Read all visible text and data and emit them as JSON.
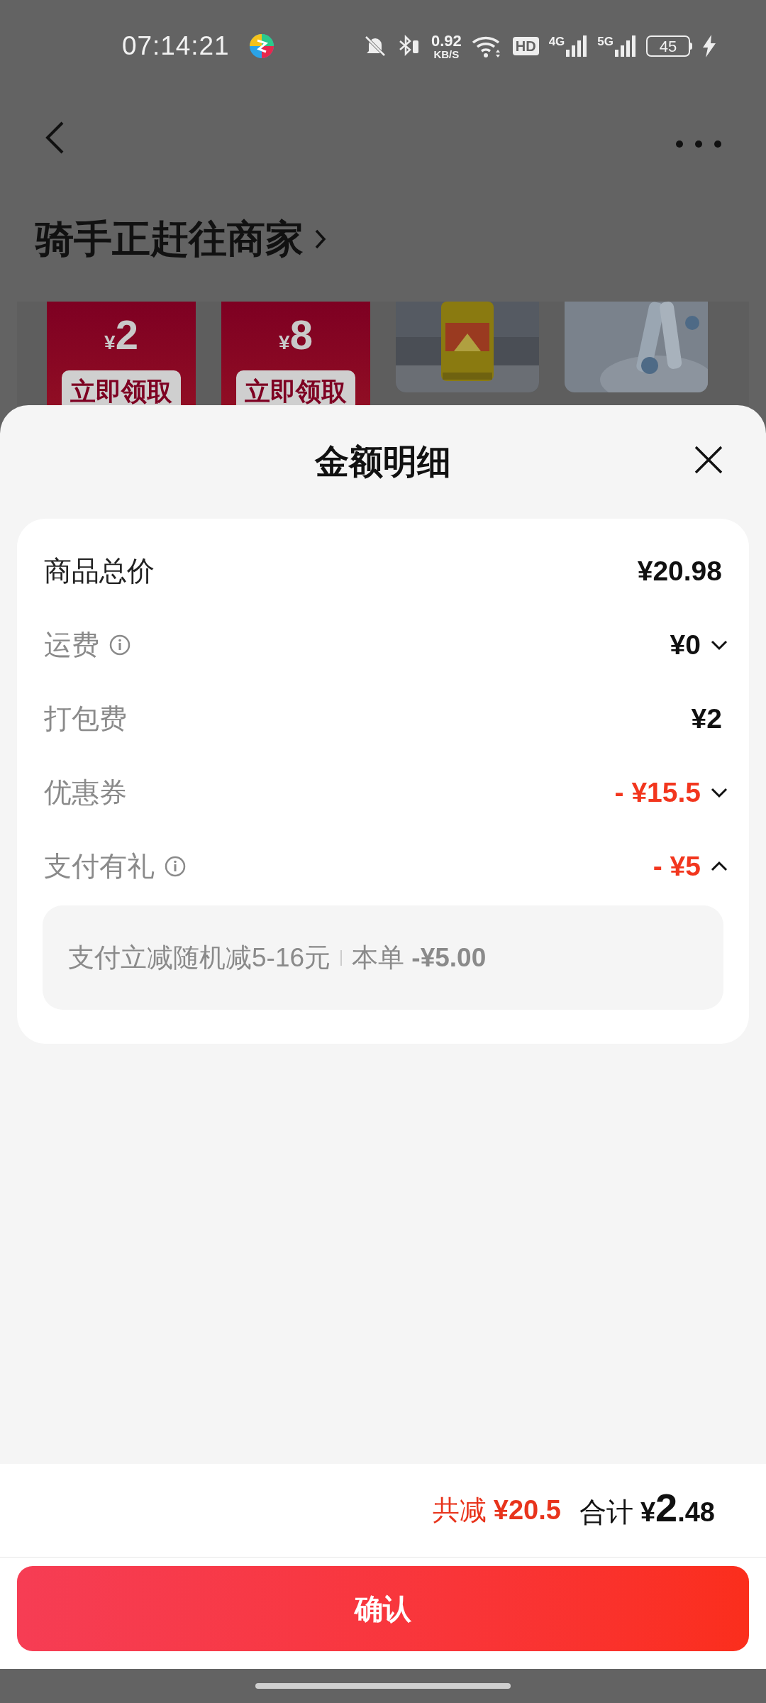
{
  "status_bar": {
    "time": "07:14:21",
    "net_speed": {
      "value": "0.92",
      "unit": "KB/S"
    },
    "hd_label": "HD",
    "signals": [
      {
        "label": "4G"
      },
      {
        "label": "5G"
      }
    ],
    "battery": "45",
    "charging": true
  },
  "top_bar": {
    "title": "骑手正赶往商家"
  },
  "promo_cards": [
    {
      "kind": "coupon",
      "currency": "¥",
      "amount": "2",
      "action": "立即领取"
    },
    {
      "kind": "coupon",
      "currency": "¥",
      "amount": "8",
      "action": "立即领取"
    },
    {
      "kind": "picture"
    },
    {
      "kind": "picture"
    }
  ],
  "sheet": {
    "title": "金额明细",
    "rows": [
      {
        "kind": "total",
        "label": "商品总价",
        "info": false,
        "value": "¥20.98"
      },
      {
        "kind": "fee",
        "label": "运费",
        "info": true,
        "value": "¥0",
        "expanded": false
      },
      {
        "kind": "fee",
        "label": "打包费",
        "info": false,
        "value": "¥2"
      },
      {
        "kind": "discount",
        "label": "优惠券",
        "info": false,
        "value": "- ¥15.5",
        "expanded": false
      },
      {
        "kind": "discount",
        "label": "支付有礼",
        "info": true,
        "value": "- ¥5",
        "expanded": true
      }
    ],
    "detail": {
      "text": "支付立减随机减5-16元",
      "note": "本单 **-¥5.00**"
    }
  },
  "footer": {
    "saving_label": "共减",
    "saving": "¥20.5",
    "total_label": "合计",
    "total_currency": "¥",
    "total_integer": "2",
    "total_decimal": ".48"
  },
  "confirm_button": "确认"
}
